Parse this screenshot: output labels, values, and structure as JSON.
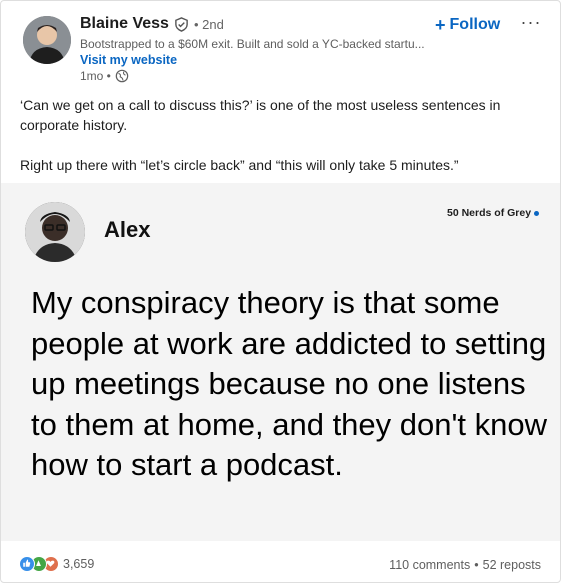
{
  "author": {
    "name": "Blaine Vess",
    "degree": "• 2nd",
    "headline": "Bootstrapped to a $60M exit. Built and sold a YC-backed startu...",
    "website_label": "Visit my website",
    "time": "1mo •",
    "follow_label": "Follow",
    "more_label": "···"
  },
  "post": {
    "paragraphs": [
      "‘Can we get on a call to discuss this?’ is one of the most useless sentences in corporate history.",
      "Right up there with “let’s circle back” and “this will only take 5 minutes.”"
    ]
  },
  "image": {
    "author": "Alex",
    "brand": "50 Nerds of Grey",
    "text": "My conspiracy theory is that some people at work are addicted to setting up meetings because no one listens to them at home, and they don't know how to start a podcast."
  },
  "footer": {
    "reaction_count": "3,659",
    "comments": "110 comments",
    "separator": "•",
    "reposts": "52 reposts",
    "reaction_icons": [
      "like-icon",
      "celebrate-icon",
      "love-icon"
    ]
  },
  "colors": {
    "accent": "#0a66c2",
    "like": "#378fe9",
    "celebrate": "#44a646",
    "love": "#df704d"
  }
}
